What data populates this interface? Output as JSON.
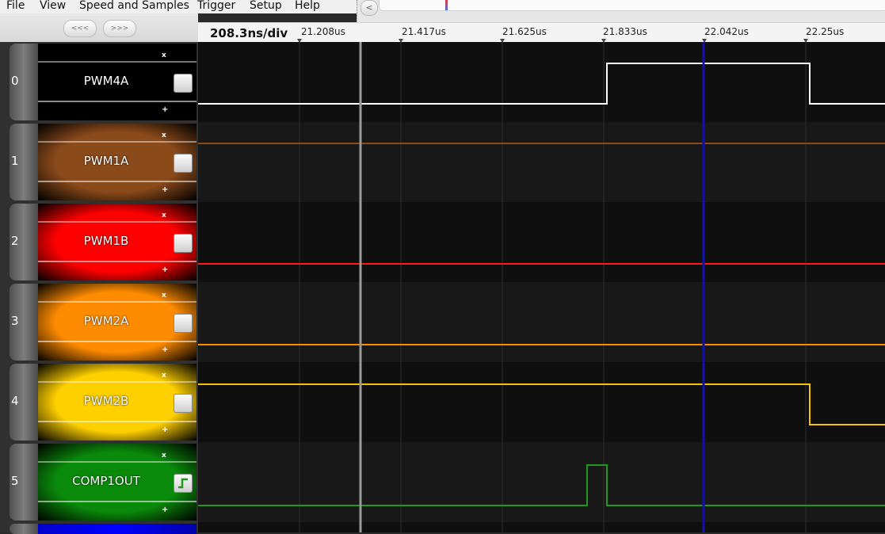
{
  "menu": [
    "File",
    "View",
    "Speed and Samples",
    "Trigger",
    "Setup",
    "Help"
  ],
  "toolbar": {
    "prev_label": "<<<",
    "next_label": ">>>"
  },
  "scroll": {
    "left_arrow": "<"
  },
  "ruler": {
    "resolution": "208.3ns/div",
    "ticks": [
      "21.208us",
      "21.417us",
      "21.625us",
      "21.833us",
      "22.042us",
      "22.25us"
    ]
  },
  "channels": [
    {
      "num": "0",
      "name": "PWM4A",
      "color": "#ffffff",
      "bg": "#000000",
      "trigger": "none"
    },
    {
      "num": "1",
      "name": "PWM1A",
      "color": "#8b4a1a",
      "bg": "#8b4a1a",
      "trigger": "none"
    },
    {
      "num": "2",
      "name": "PWM1B",
      "color": "#ff1a1a",
      "bg": "#ff0000",
      "trigger": "none"
    },
    {
      "num": "3",
      "name": "PWM2A",
      "color": "#ff8c00",
      "bg": "#ff8c00",
      "trigger": "none"
    },
    {
      "num": "4",
      "name": "PWM2B",
      "color": "#f5c400",
      "bg": "#ffd000",
      "trigger": "none"
    },
    {
      "num": "5",
      "name": "COMP1OUT",
      "color": "#1f9a1f",
      "bg": "#0a8a0a",
      "trigger": "rising-edge"
    }
  ],
  "icons": {
    "remove": "close-icon",
    "add": "plus-icon",
    "trigger": "rising-edge-icon"
  },
  "channel_labels": {
    "remove": "x",
    "add": "+"
  }
}
